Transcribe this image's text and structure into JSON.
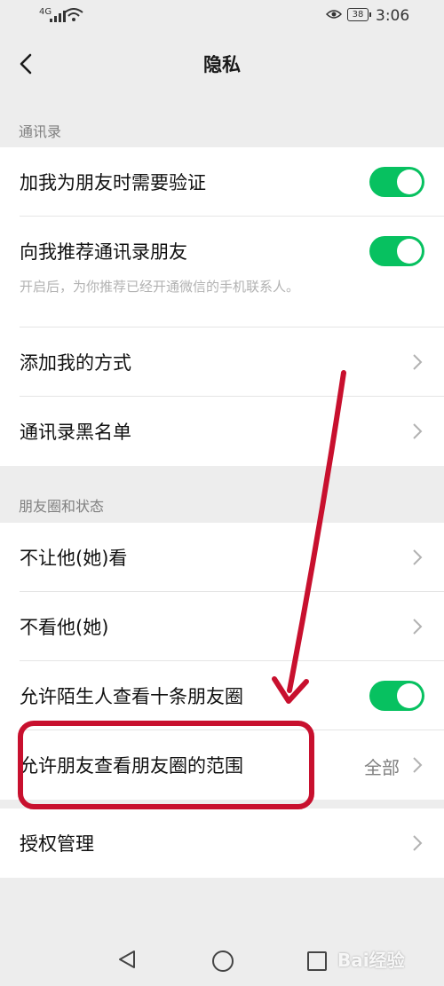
{
  "status_bar": {
    "signal": "4G",
    "battery": "38",
    "time": "3:06"
  },
  "nav": {
    "title": "隐私"
  },
  "contacts_section": {
    "label": "通讯录",
    "rows": [
      {
        "label": "加我为朋友时需要验证",
        "toggle": "on"
      },
      {
        "label": "向我推荐通讯录朋友",
        "toggle": "on",
        "hint": "开启后，为你推荐已经开通微信的手机联系人。"
      },
      {
        "label": "添加我的方式"
      },
      {
        "label": "通讯录黑名单"
      }
    ]
  },
  "moments_section": {
    "label": "朋友圈和状态",
    "rows": [
      {
        "label": "不让他(她)看"
      },
      {
        "label": "不看他(她)"
      },
      {
        "label": "允许陌生人查看十条朋友圈",
        "toggle": "on"
      },
      {
        "label": "允许朋友查看朋友圈的范围",
        "value": "全部"
      }
    ]
  },
  "other_section": {
    "rows": [
      {
        "label": "授权管理"
      }
    ]
  },
  "watermark": "Bai经验",
  "colors": {
    "toggle_on": "#07c160",
    "annotation": "#c8102e",
    "background": "#ededed"
  }
}
